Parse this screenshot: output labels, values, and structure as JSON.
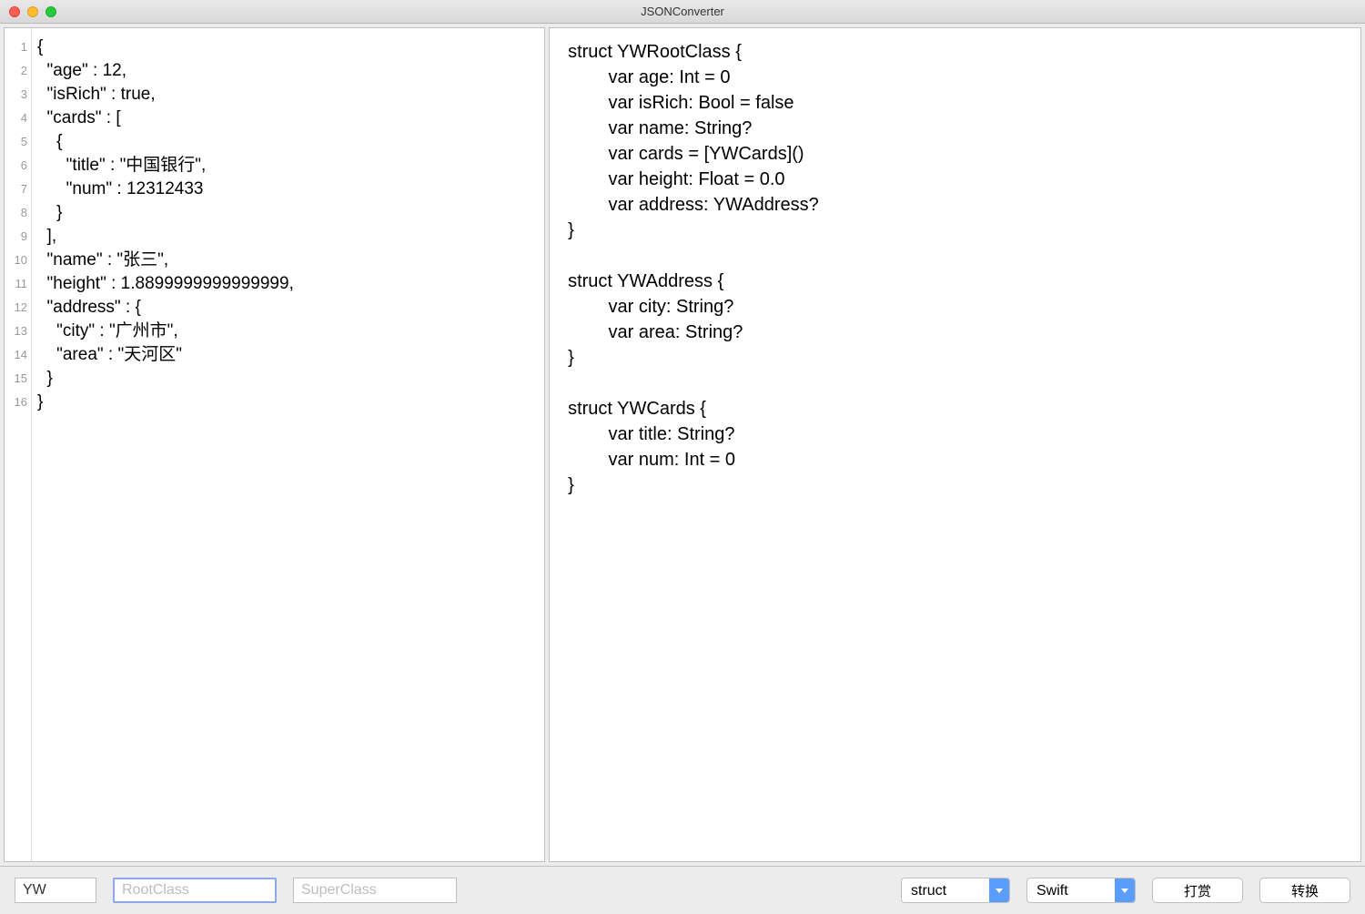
{
  "window": {
    "title": "JSONConverter"
  },
  "leftPane": {
    "lineNumbers": [
      "1",
      "2",
      "3",
      "4",
      "5",
      "6",
      "7",
      "8",
      "9",
      "10",
      "11",
      "12",
      "13",
      "14",
      "15",
      "16"
    ],
    "code": "{\n  \"age\" : 12,\n  \"isRich\" : true,\n  \"cards\" : [\n    {\n      \"title\" : \"中国银行\",\n      \"num\" : 12312433\n    }\n  ],\n  \"name\" : \"张三\",\n  \"height\" : 1.8899999999999999,\n  \"address\" : {\n    \"city\" : \"广州市\",\n    \"area\" : \"天河区\"\n  }\n}"
  },
  "rightPane": {
    "code": "struct YWRootClass {\n        var age: Int = 0\n        var isRich: Bool = false\n        var name: String?\n        var cards = [YWCards]()\n        var height: Float = 0.0\n        var address: YWAddress?\n}\n\nstruct YWAddress {\n        var city: String?\n        var area: String?\n}\n\nstruct YWCards {\n        var title: String?\n        var num: Int = 0\n}"
  },
  "bottomBar": {
    "prefix": {
      "value": "YW"
    },
    "rootClass": {
      "placeholder": "RootClass",
      "value": ""
    },
    "superClass": {
      "placeholder": "SuperClass",
      "value": ""
    },
    "typeSelect": {
      "value": "struct"
    },
    "languageSelect": {
      "value": "Swift"
    },
    "donateButton": "打赏",
    "convertButton": "转换"
  }
}
